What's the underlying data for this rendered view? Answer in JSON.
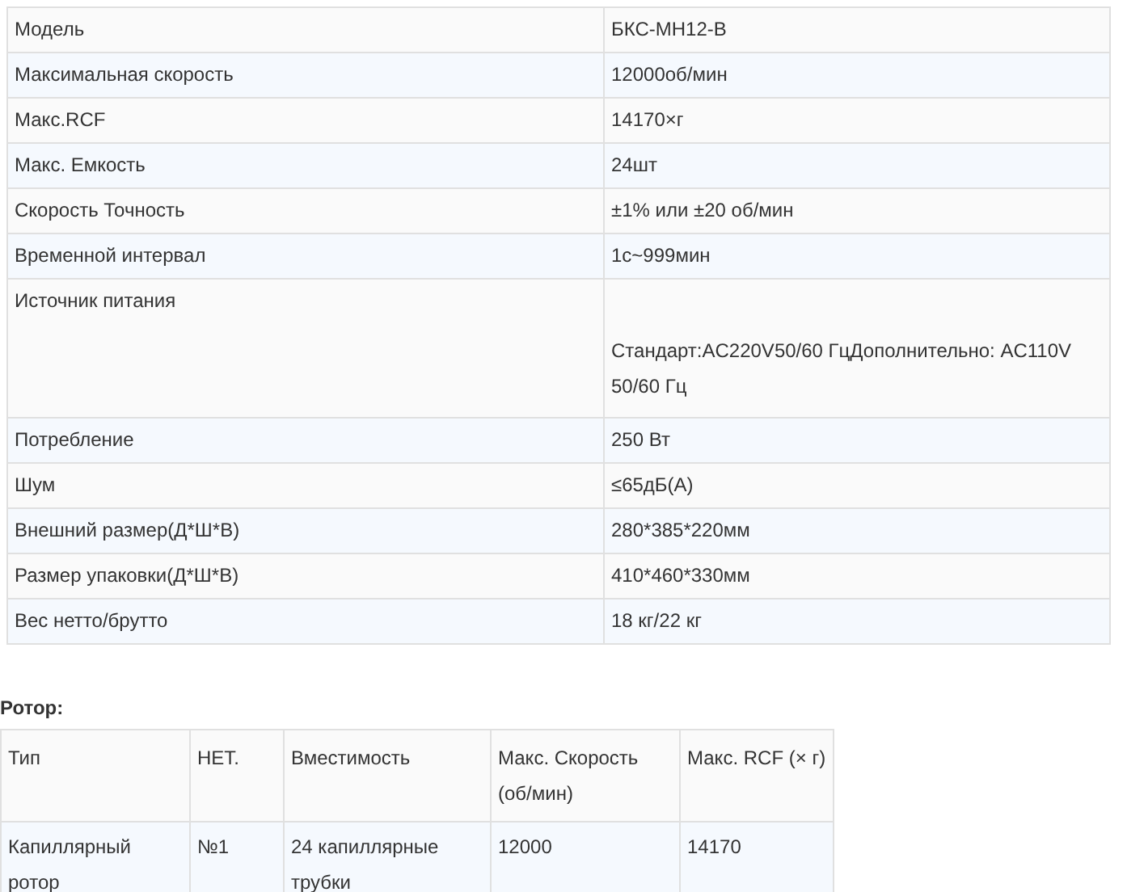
{
  "specs": [
    {
      "label": "Модель",
      "value": "БКС-МН12-В"
    },
    {
      "label": "Максимальная скорость",
      "value": "12000об/мин"
    },
    {
      "label": "Макс.RCF",
      "value": "14170×г"
    },
    {
      "label": "Макс. Емкость",
      "value": "24шт"
    },
    {
      "label": "Скорость Точность",
      "value": "±1% или ±20 об/мин"
    },
    {
      "label": "Временной интервал",
      "value": "1с~999мин"
    },
    {
      "label": "Источник питания",
      "value": "Стандарт:AC220V50/60 ГцДополнительно: AC110V 50/60 Гц"
    },
    {
      "label": "Потребление",
      "value": "250 Вт"
    },
    {
      "label": "Шум",
      "value": "≤65дБ(A)"
    },
    {
      "label": "Внешний размер(Д*Ш*В)",
      "value": "280*385*220мм"
    },
    {
      "label": "Размер упаковки(Д*Ш*В)",
      "value": "410*460*330мм"
    },
    {
      "label": "Вес нетто/брутто",
      "value": "18 кг/22 кг"
    }
  ],
  "rotor": {
    "title": "Ротор:",
    "columns": [
      "Тип",
      "НЕТ.",
      "Вместимость",
      "Макс. Скорость (об/мин)",
      "Макс. RCF (× г)"
    ],
    "rows": [
      [
        "Капиллярный ротор",
        "№1",
        "24 капиллярные трубки",
        "12000",
        "14170"
      ]
    ]
  }
}
